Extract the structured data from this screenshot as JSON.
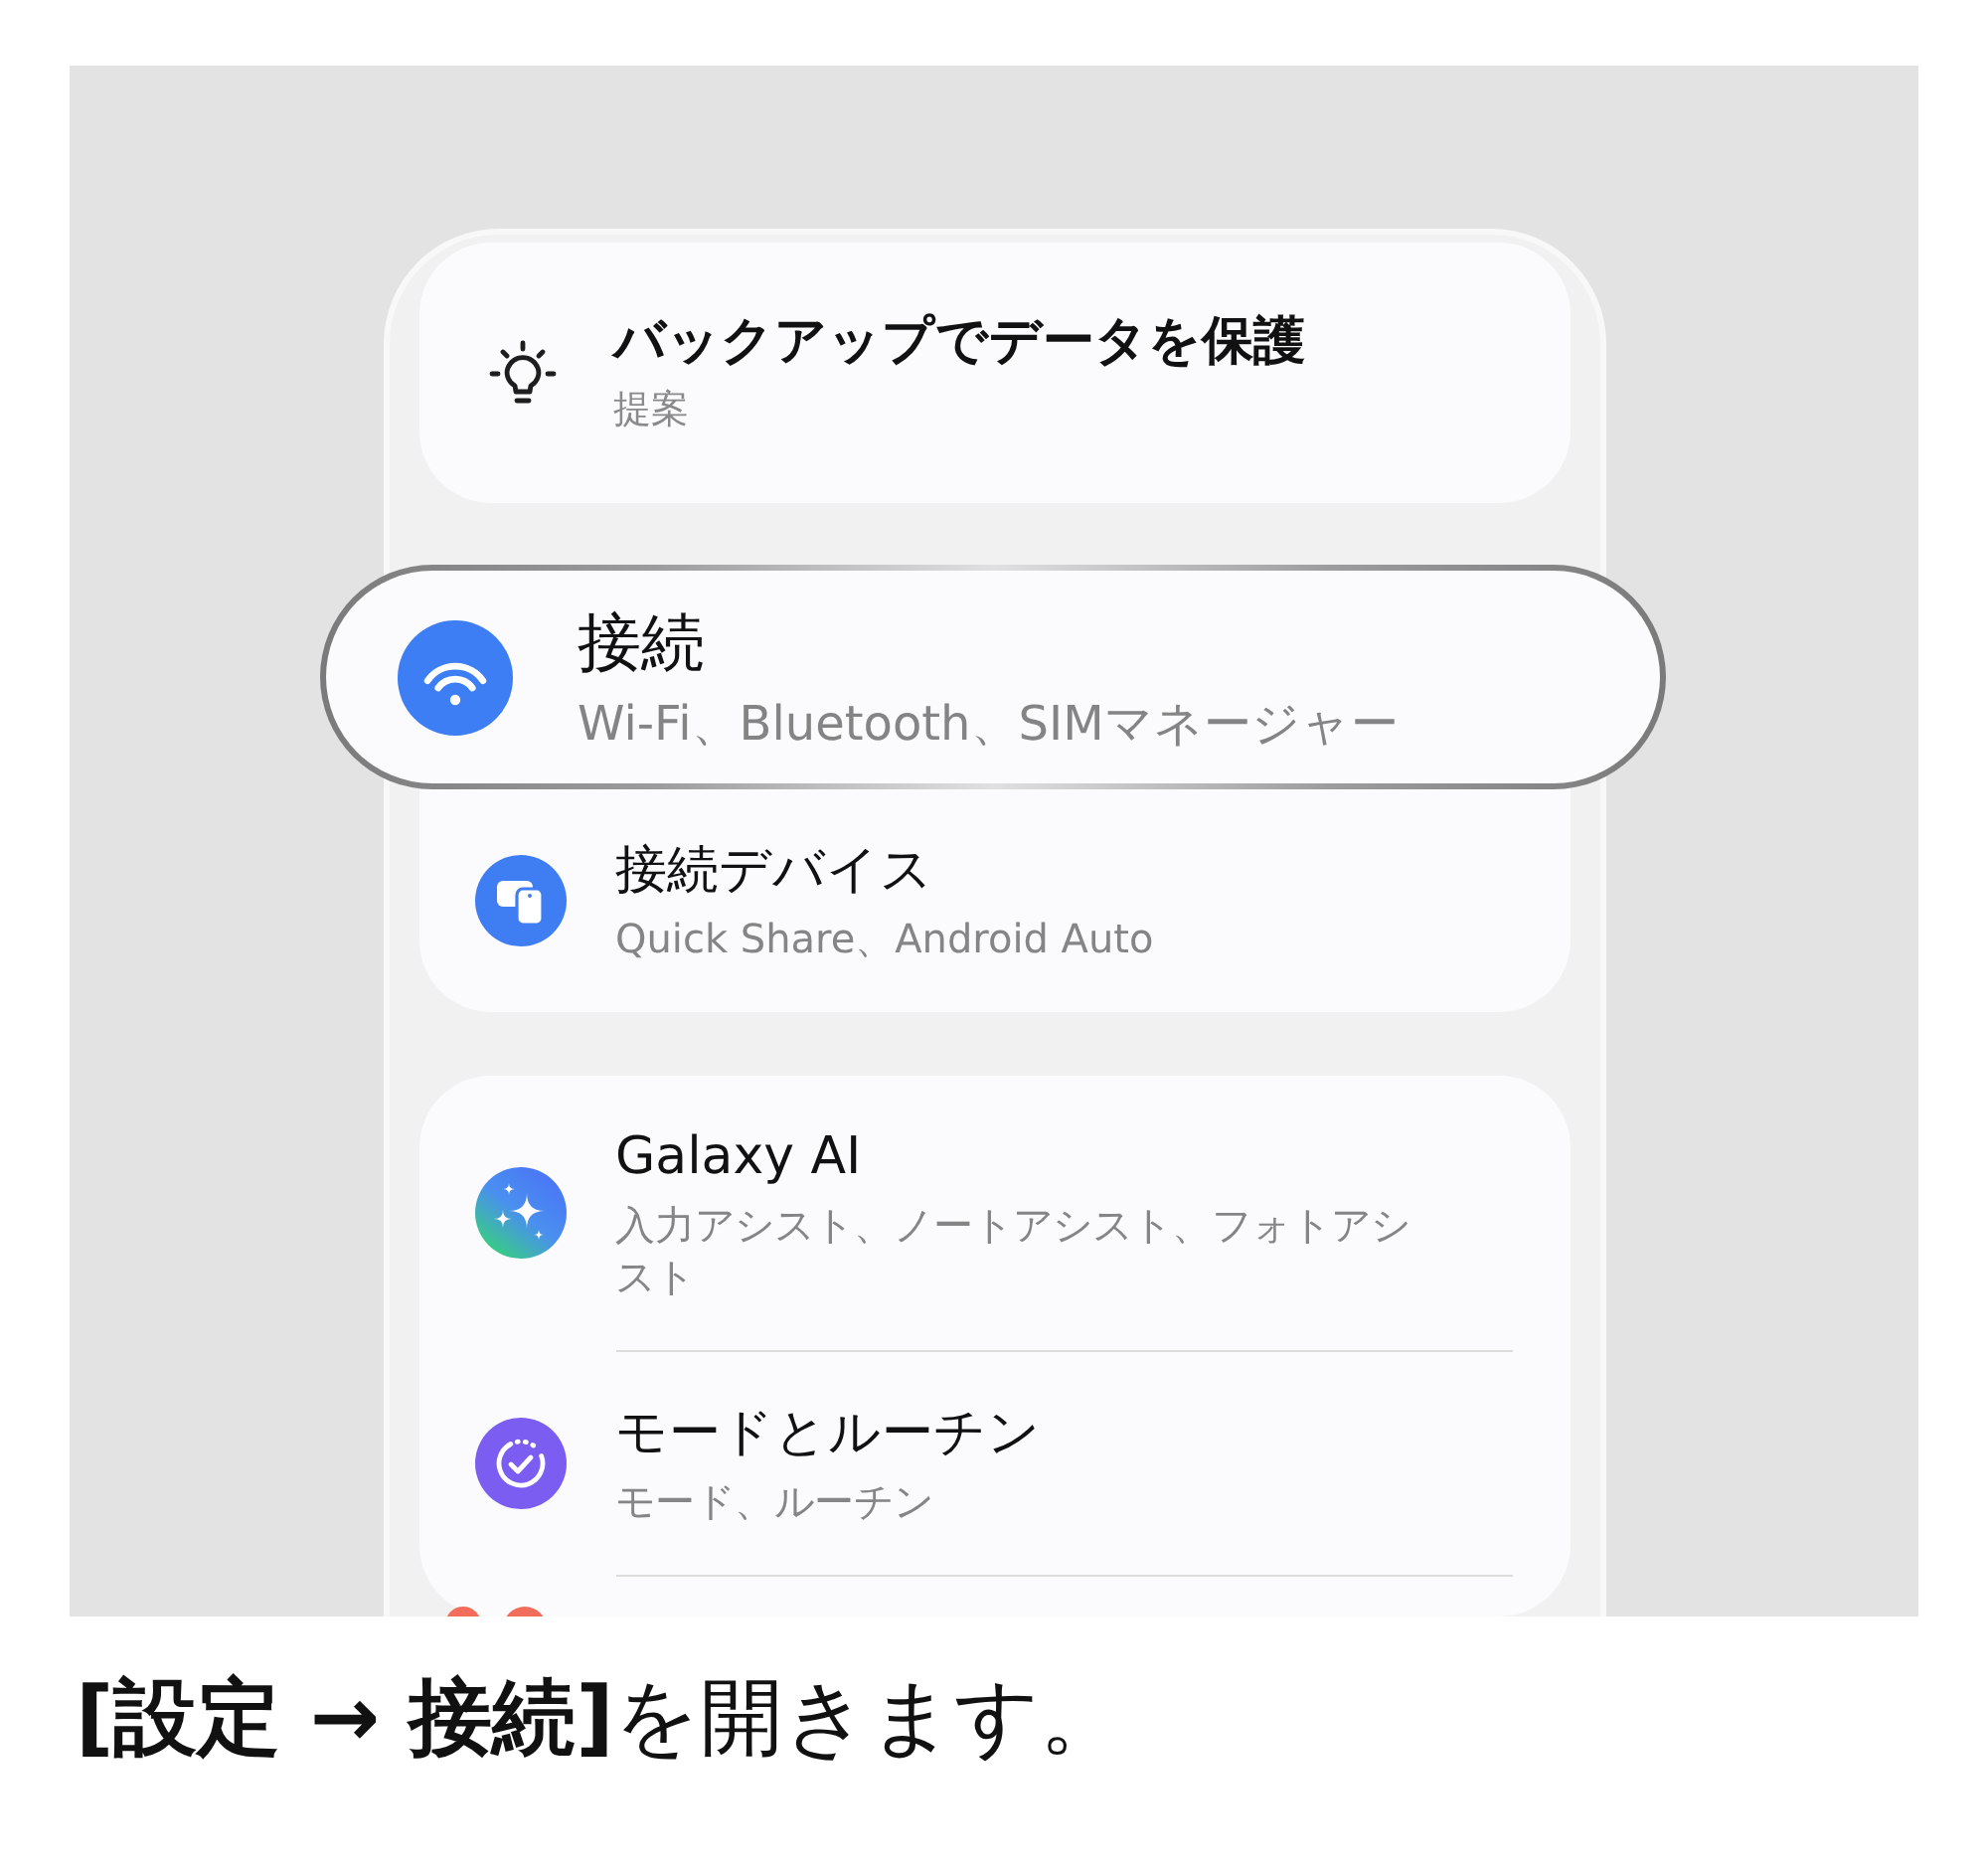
{
  "suggestion": {
    "title": "バックアップでデータを保護",
    "label": "提案"
  },
  "groups": [
    {
      "more_below": false,
      "items": [
        {
          "kind": "wifi",
          "highlighted": true,
          "title": "接続",
          "subtitle": "Wi-Fi、Bluetooth、SIMマネージャー"
        },
        {
          "kind": "devices",
          "highlighted": false,
          "title": "接続デバイス",
          "subtitle": "Quick Share、Android Auto"
        }
      ]
    },
    {
      "more_below": true,
      "items": [
        {
          "kind": "ai",
          "highlighted": false,
          "title": "Galaxy AI",
          "subtitle": "入力アシスト、ノートアシスト、フォトアシスト"
        },
        {
          "kind": "routine",
          "highlighted": false,
          "title": "モードとルーチン",
          "subtitle": "モード、ルーチン"
        }
      ]
    }
  ],
  "caption": "**[設定 → 接続]**を開きます。"
}
